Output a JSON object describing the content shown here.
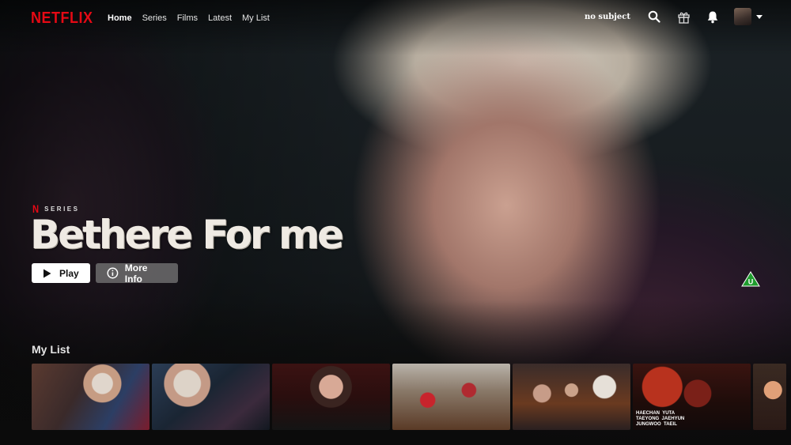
{
  "app": {
    "logo": "NETFLIX",
    "brand_color": "#e50914"
  },
  "nav": {
    "links": [
      {
        "label": "Home",
        "active": true
      },
      {
        "label": "Series",
        "active": false
      },
      {
        "label": "Films",
        "active": false
      },
      {
        "label": "Latest",
        "active": false
      },
      {
        "label": "My List",
        "active": false
      }
    ],
    "profile_name": "no subject",
    "icons": [
      "search-icon",
      "gift-icon",
      "bell-icon",
      "avatar",
      "caret-down-icon"
    ]
  },
  "hero": {
    "series_mark": "N",
    "series_label": "SERIES",
    "title": "Bethere For me",
    "play_label": "Play",
    "info_label": "More Info",
    "rating": "U",
    "rating_color": "#1f9d2e"
  },
  "my_list": {
    "title": "My List",
    "items": [
      {
        "caption": ""
      },
      {
        "caption": ""
      },
      {
        "caption": ""
      },
      {
        "caption": ""
      },
      {
        "caption": ""
      },
      {
        "caption": "HAECHAN  YUTA\nTAEYONG  JAEHYUN\nJUNGWOO  TAEIL"
      },
      {
        "caption": ""
      }
    ]
  }
}
